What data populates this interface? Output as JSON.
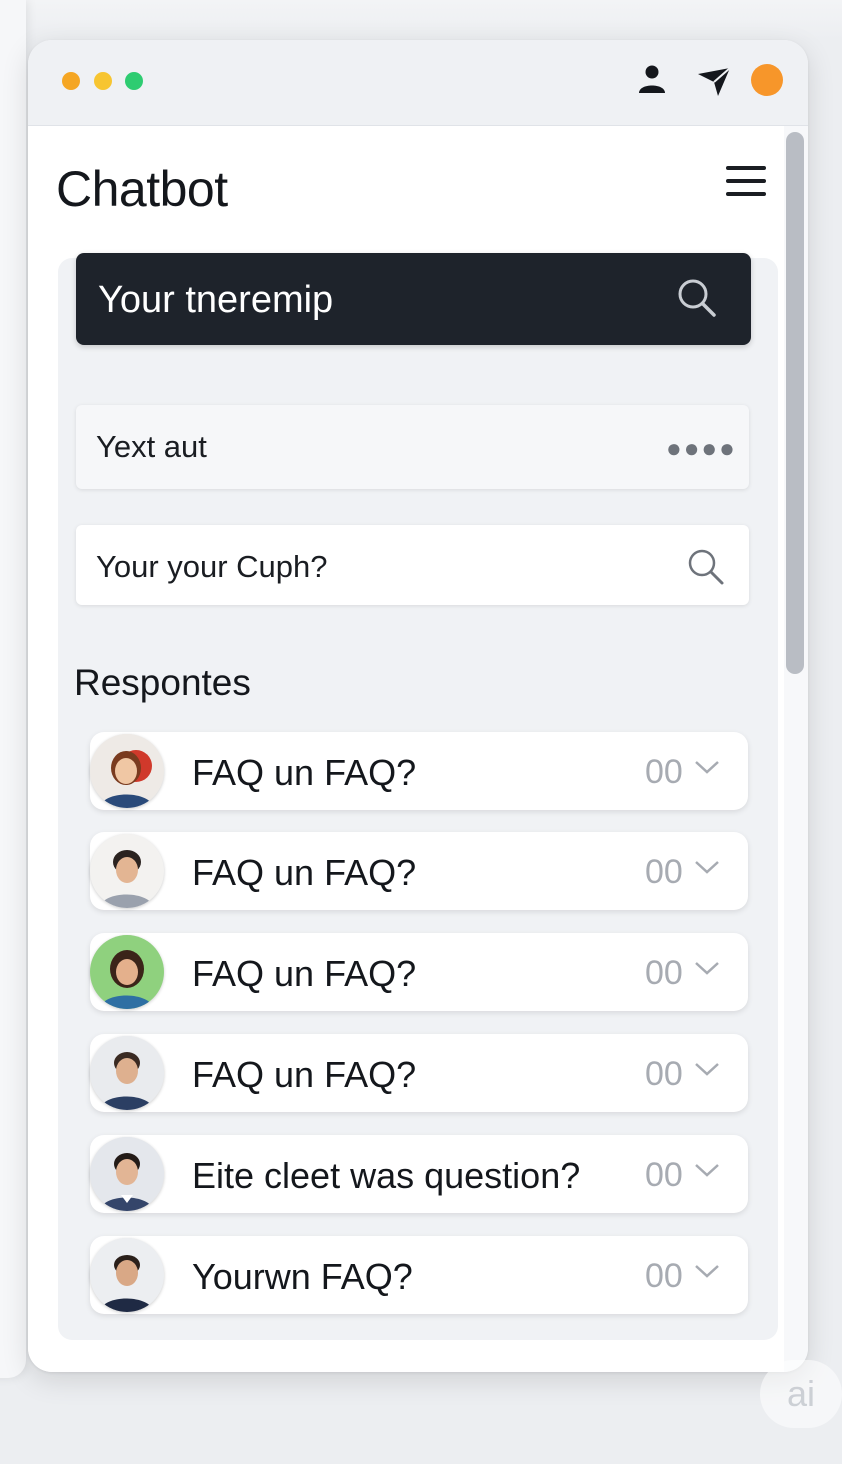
{
  "window": {
    "title": "Chatbot",
    "traffic_lights": [
      "#f5a623",
      "#f7c531",
      "#2ecc71"
    ],
    "toolbar_icons": [
      "user-icon",
      "send-icon",
      "status-dot-icon"
    ],
    "accent": "#f7962a"
  },
  "search": {
    "primary_placeholder": "Your tneremip",
    "text_field": "Yext aut",
    "secondary_placeholder": "Your your Cuph?"
  },
  "responses": {
    "heading": "Respontes",
    "items": [
      {
        "question": "FAQ un FAQ?",
        "count": "00",
        "avatar": "avatar-woman-red-hair"
      },
      {
        "question": "FAQ un FAQ?",
        "count": "00",
        "avatar": "avatar-man-dark-hair"
      },
      {
        "question": "FAQ un FAQ?",
        "count": "00",
        "avatar": "avatar-woman-green-bg"
      },
      {
        "question": "FAQ un FAQ?",
        "count": "00",
        "avatar": "avatar-man-blue-jacket"
      },
      {
        "question": "Eite cleet was question?",
        "count": "00",
        "avatar": "avatar-man-glasses"
      },
      {
        "question": "Yourwn FAQ?",
        "count": "00",
        "avatar": "avatar-man-navy-shirt"
      }
    ]
  },
  "watermark": "ai"
}
